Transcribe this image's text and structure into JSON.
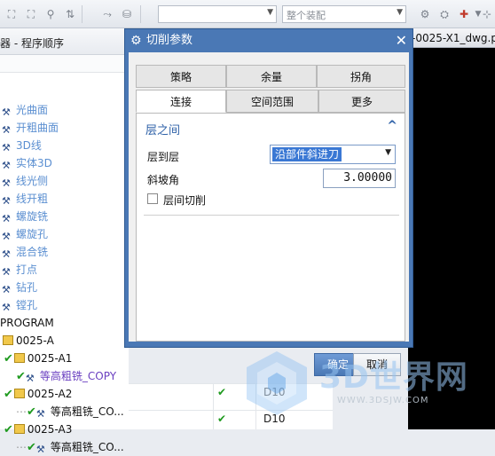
{
  "toolbar": {
    "combo_empty": "",
    "assembly_combo": "整个装配"
  },
  "navigator": {
    "header": "器 - 程序顺序",
    "rows": [
      {
        "label": "光曲面",
        "style": "type"
      },
      {
        "label": "开粗曲面",
        "style": "type"
      },
      {
        "label": "3D线",
        "style": "type"
      },
      {
        "label": "实体3D",
        "style": "type"
      },
      {
        "label": "线光侧",
        "style": "type"
      },
      {
        "label": "线开粗",
        "style": "type"
      },
      {
        "label": "螺旋铣",
        "style": "type"
      },
      {
        "label": "螺旋孔",
        "style": "type"
      },
      {
        "label": "混合铣",
        "style": "type"
      },
      {
        "label": "打点",
        "style": "type"
      },
      {
        "label": "钻孔",
        "style": "type"
      },
      {
        "label": "镗孔",
        "style": "type"
      },
      {
        "label": "PROGRAM",
        "style": "dark"
      },
      {
        "label": "0025-A",
        "style": "dark"
      },
      {
        "label": "0025-A1",
        "style": "dark"
      },
      {
        "label": "等高粗铣_COPY",
        "style": "link"
      },
      {
        "label": "0025-A2",
        "style": "dark"
      },
      {
        "label": "等高粗铣_CO...",
        "style": "dark"
      },
      {
        "label": "0025-A3",
        "style": "dark"
      },
      {
        "label": "等高粗铣_CO...",
        "style": "dark"
      }
    ]
  },
  "strip": {
    "rows": [
      {
        "tool": "D10"
      },
      {
        "tool": "D10"
      }
    ]
  },
  "graphics": {
    "title": "-0025-X1_dwg.p"
  },
  "dialog": {
    "title": "切削参数",
    "tabs_row1": [
      "策略",
      "余量",
      "拐角"
    ],
    "tabs_row2": [
      "连接",
      "空间范围",
      "更多"
    ],
    "active_tab": "连接",
    "group_title": "层之间",
    "layer_to_layer_label": "层到层",
    "layer_to_layer_value": "沿部件斜进刀",
    "ramp_angle_label": "斜坡角",
    "ramp_angle_value": "3.00000",
    "cut_between_levels_label": "层间切削",
    "ok": "确定",
    "cancel": "取消"
  },
  "watermark": {
    "brand": "3D世界网",
    "url": "WWW.3DSJW.COM"
  },
  "colors": {
    "dialog_titlebar": "#4a78b5",
    "group_title": "#2f62a8",
    "check_green": "#1f9a1f",
    "link_purple": "#6a3fc0"
  }
}
